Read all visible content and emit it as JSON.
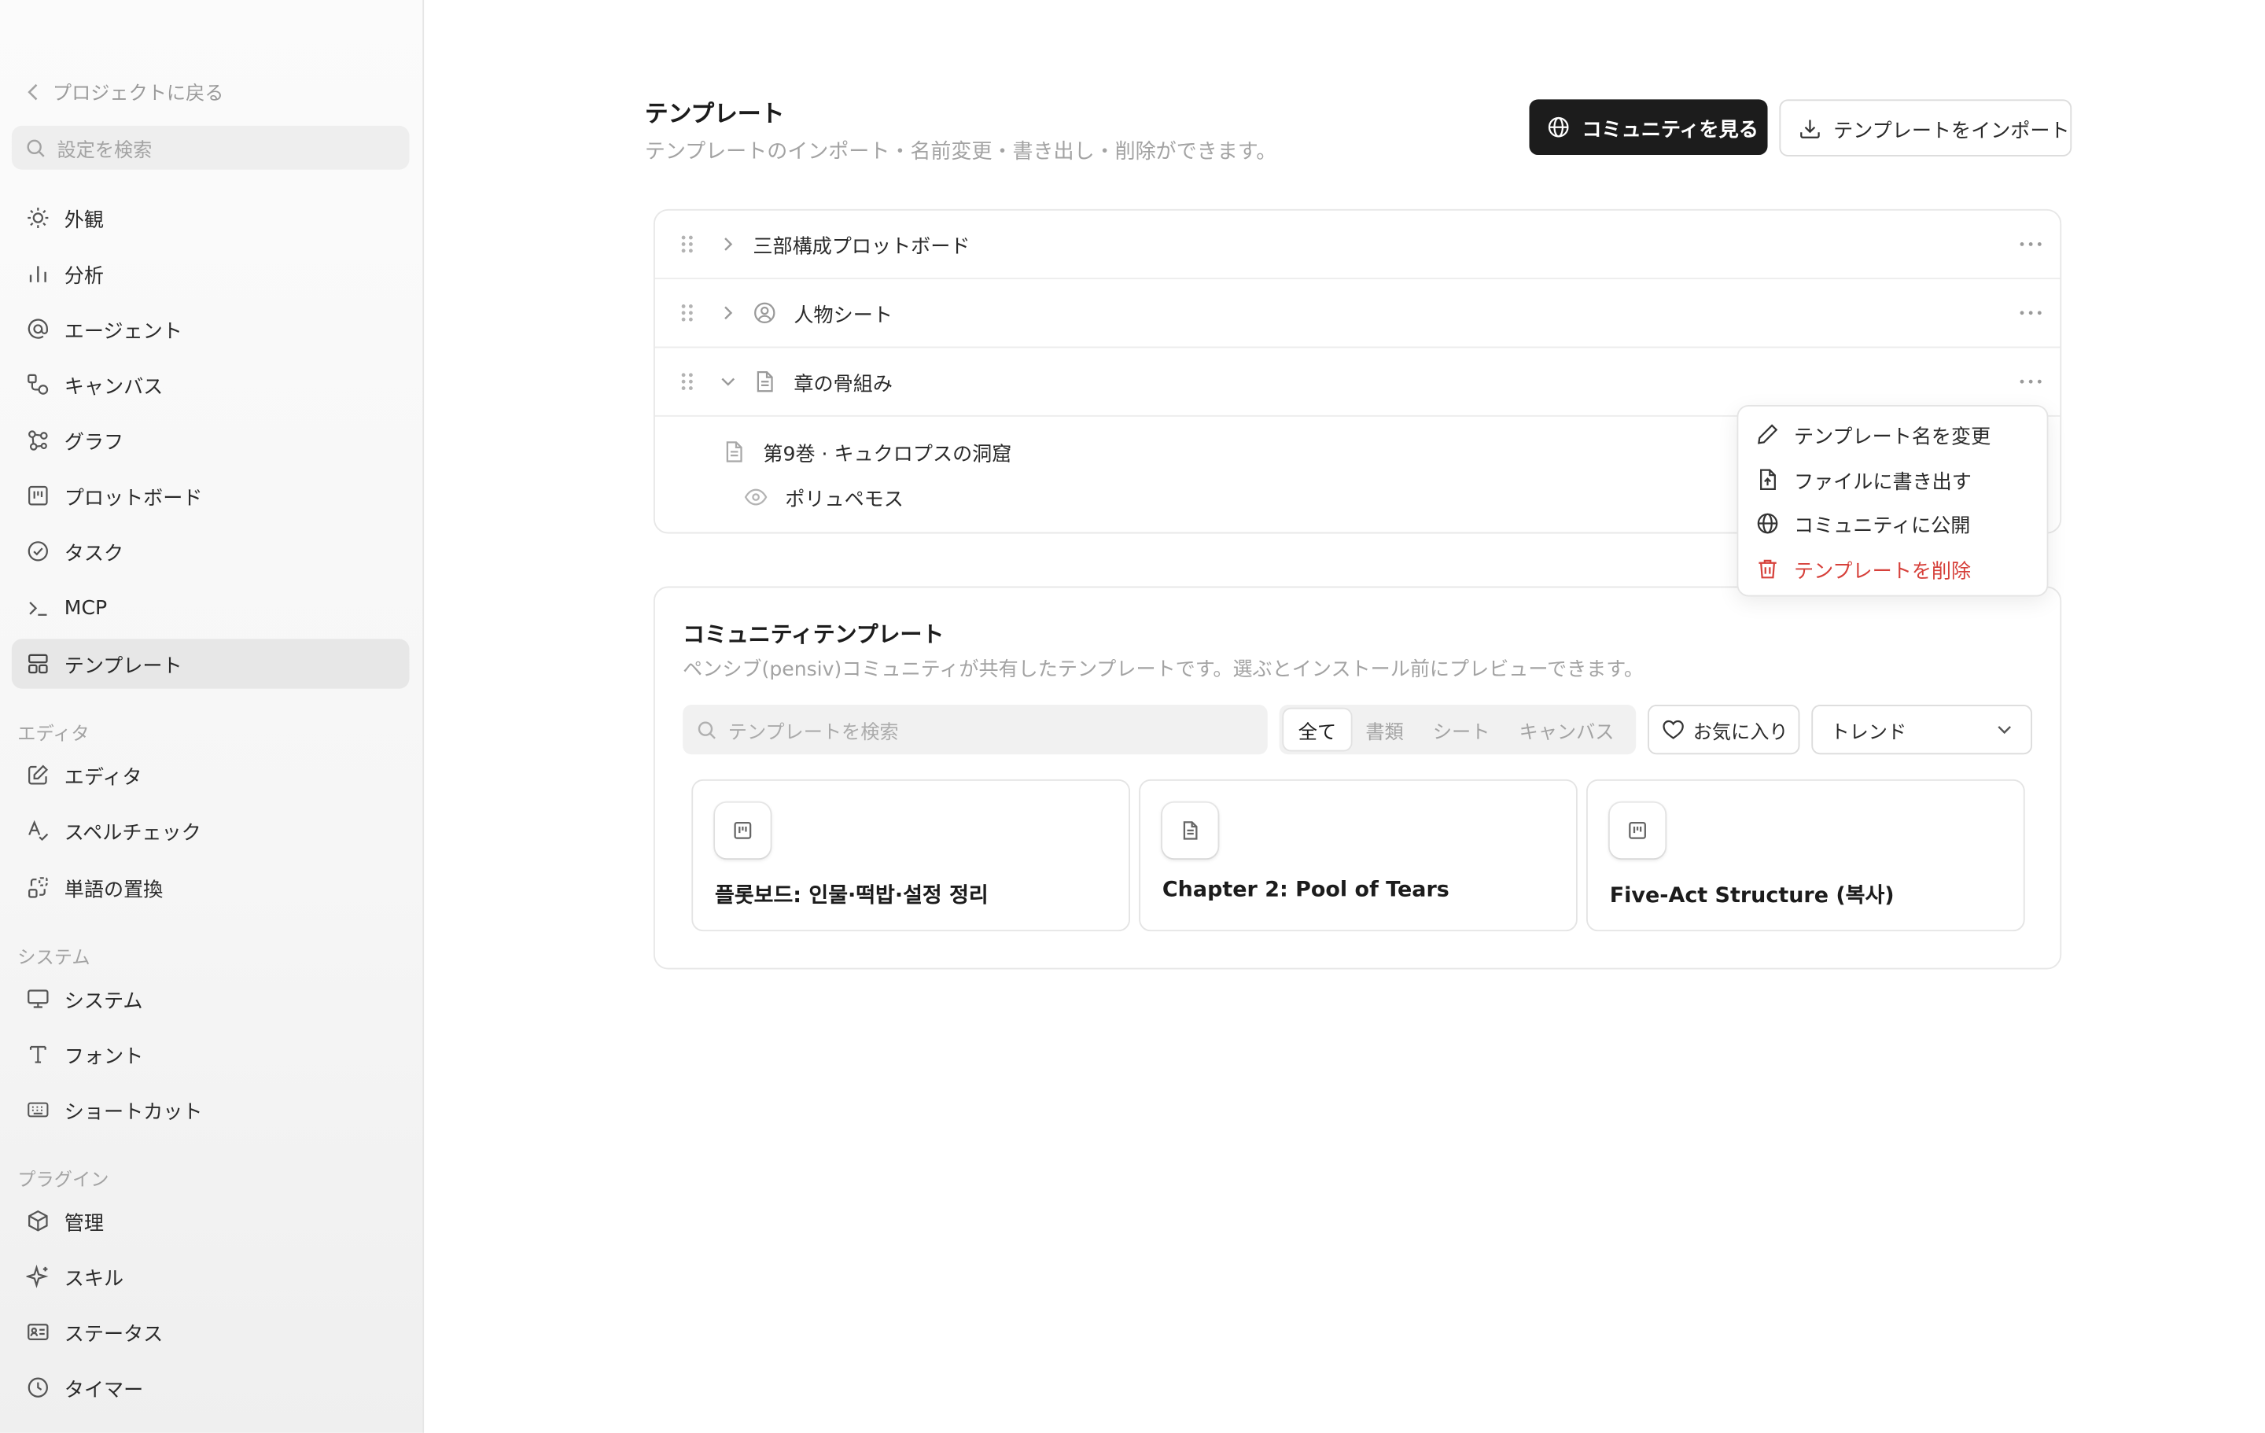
{
  "sidebar": {
    "back_label": "プロジェクトに戻る",
    "search_placeholder": "設定を検索",
    "items": [
      {
        "label": "外観",
        "icon": "sun-icon"
      },
      {
        "label": "分析",
        "icon": "bar-chart-icon"
      },
      {
        "label": "エージェント",
        "icon": "at-sign-icon"
      },
      {
        "label": "キャンバス",
        "icon": "canvas-icon"
      },
      {
        "label": "グラフ",
        "icon": "graph-icon"
      },
      {
        "label": "プロットボード",
        "icon": "plotboard-icon"
      },
      {
        "label": "タスク",
        "icon": "check-circle-icon"
      },
      {
        "label": "MCP",
        "icon": "terminal-icon"
      },
      {
        "label": "テンプレート",
        "icon": "template-icon",
        "active": true
      }
    ],
    "sections": {
      "editor": "エディタ",
      "system": "システム",
      "plugin": "プラグイン"
    },
    "editor_items": [
      {
        "label": "エディタ",
        "icon": "edit-icon"
      },
      {
        "label": "スペルチェック",
        "icon": "spellcheck-icon"
      },
      {
        "label": "単語の置換",
        "icon": "replace-icon"
      }
    ],
    "system_items": [
      {
        "label": "システム",
        "icon": "monitor-icon"
      },
      {
        "label": "フォント",
        "icon": "font-icon"
      },
      {
        "label": "ショートカット",
        "icon": "keyboard-icon"
      }
    ],
    "plugin_items": [
      {
        "label": "管理",
        "icon": "package-icon"
      },
      {
        "label": "スキル",
        "icon": "sparkle-icon"
      },
      {
        "label": "ステータス",
        "icon": "id-card-icon"
      },
      {
        "label": "タイマー",
        "icon": "clock-icon"
      }
    ]
  },
  "header": {
    "title": "テンプレート",
    "subtitle": "テンプレートのインポート・名前変更・書き出し・削除ができます。",
    "community_button": "コミュニティを見る",
    "import_button": "テンプレートをインポート"
  },
  "templates": [
    {
      "name": "三部構成プロットボード",
      "expanded": false
    },
    {
      "name": "人物シート",
      "expanded": false
    },
    {
      "name": "章の骨組み",
      "expanded": true,
      "children": {
        "doc": "第9巻 · キュクロプスの洞窟",
        "sub": "ポリュペモス"
      }
    }
  ],
  "context_menu": {
    "rename": "テンプレート名を変更",
    "export": "ファイルに書き出す",
    "publish": "コミュニティに公開",
    "delete": "テンプレートを削除"
  },
  "community": {
    "title": "コミュニティテンプレート",
    "description": "ペンシブ(pensiv)コミュニティが共有したテンプレートです。選ぶとインストール前にプレビューできます。",
    "search_placeholder": "テンプレートを検索",
    "filters": [
      "全て",
      "書類",
      "シート",
      "キャンバス"
    ],
    "favorites": "お気に入り",
    "sort": "トレンド",
    "cards": [
      {
        "name": "플롯보드: 인물·떡밥·설정 정리",
        "icon": "plotboard-icon"
      },
      {
        "name": "Chapter 2: Pool of Tears",
        "icon": "document-icon"
      },
      {
        "name": "Five-Act Structure (복사)",
        "icon": "plotboard-icon"
      }
    ]
  },
  "colors": {
    "accent_dark": "#1c1c1c",
    "danger": "#d6403a",
    "muted": "#a3a3a3"
  }
}
